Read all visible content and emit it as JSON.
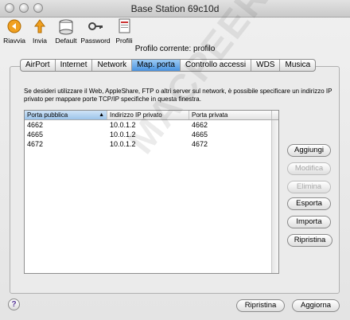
{
  "window": {
    "title": "Base Station 69c10d"
  },
  "toolbar": {
    "items": [
      {
        "label": "Riavvia",
        "icon": "restart-icon"
      },
      {
        "label": "Invia",
        "icon": "upload-icon"
      },
      {
        "label": "Default",
        "icon": "default-icon"
      },
      {
        "label": "Password",
        "icon": "key-icon"
      },
      {
        "label": "Profili",
        "icon": "profiles-icon"
      }
    ]
  },
  "profile": {
    "text": "Profilo corrente: profilo"
  },
  "tabs": [
    {
      "label": "AirPort"
    },
    {
      "label": "Internet"
    },
    {
      "label": "Network"
    },
    {
      "label": "Map. porta",
      "active": true
    },
    {
      "label": "Controllo accessi"
    },
    {
      "label": "WDS"
    },
    {
      "label": "Musica"
    }
  ],
  "description": "Se desideri utilizzare il Web, AppleShare, FTP o altri server sul network, è possibile specificare un indirizzo IP privato per mappare porte TCP/IP specifiche in questa finestra.",
  "table": {
    "columns": [
      "Porta pubblica",
      "Indirizzo IP privato",
      "Porta privata"
    ],
    "rows": [
      [
        "4662",
        "10.0.1.2",
        "4662"
      ],
      [
        "4665",
        "10.0.1.2",
        "4665"
      ],
      [
        "4672",
        "10.0.1.2",
        "4672"
      ]
    ]
  },
  "side_buttons": {
    "add": "Aggiungi",
    "edit": "Modifica",
    "delete": "Elimina",
    "export": "Esporta",
    "import": "Importa",
    "restore": "Ripristina"
  },
  "footer": {
    "help": "?",
    "revert": "Ripristina",
    "update": "Aggiorna"
  },
  "watermark": "MACPEER",
  "colors": {
    "accent": "#4a93e0"
  }
}
